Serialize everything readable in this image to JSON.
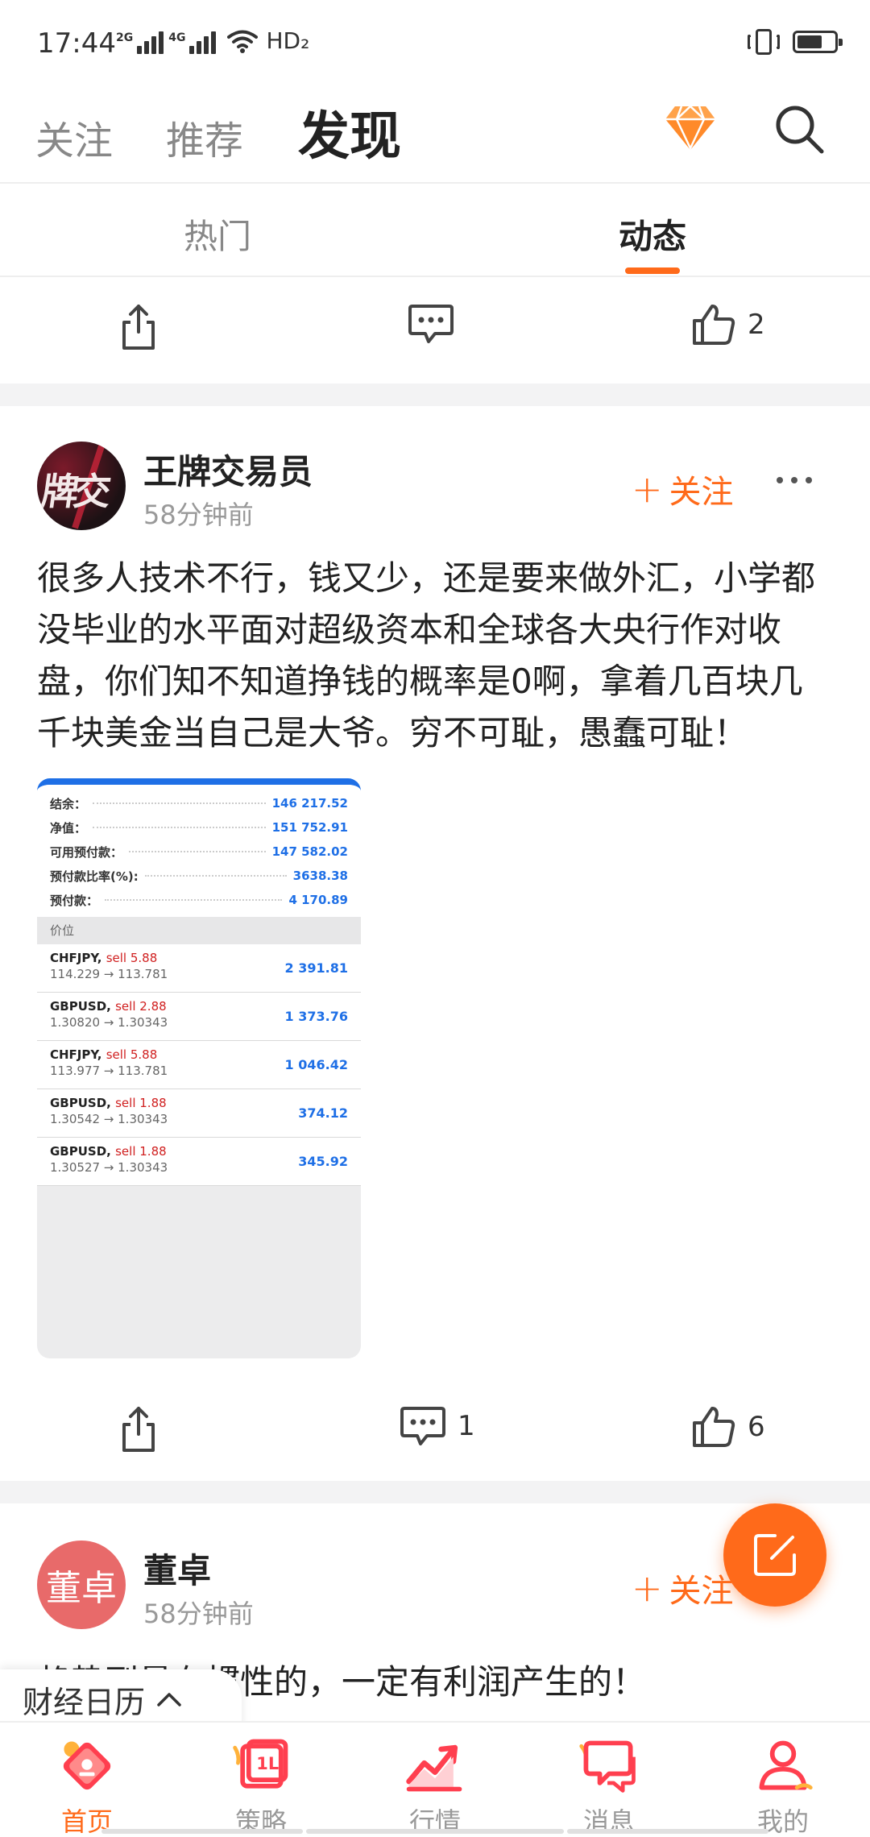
{
  "status_bar": {
    "time": "17:44",
    "network_1": "2G",
    "network_2": "4G",
    "hd": "HD₂",
    "vibrate_icon": "vibrate-icon",
    "battery_icon": "battery-icon"
  },
  "top_nav": {
    "tabs": [
      {
        "label": "关注"
      },
      {
        "label": "推荐"
      },
      {
        "label": "发现"
      }
    ],
    "active_tab": "发现",
    "diamond_icon": "diamond-icon",
    "search_icon": "search-icon"
  },
  "sub_tabs": {
    "tabs": [
      {
        "label": "热门"
      },
      {
        "label": "动态"
      }
    ],
    "active_tab": "动态"
  },
  "prev_post_actions": {
    "comments": "",
    "likes": "2"
  },
  "post1": {
    "author": "王牌交易员",
    "avatar_text": "牌交",
    "time": "58分钟前",
    "follow": "关注",
    "text": "很多人技术不行，钱又少，还是要来做外汇，小学都没毕业的水平面对超级资本和全球各大央行作对收盘，你们知不知道挣钱的概率是0啊，拿着几百块几千块美金当自己是大爷。穷不可耻，愚蠢可耻！",
    "screenshot": {
      "account": [
        {
          "label": "结余：",
          "value": "146 217.52"
        },
        {
          "label": "净值：",
          "value": "151 752.91"
        },
        {
          "label": "可用预付款：",
          "value": "147 582.02"
        },
        {
          "label": "预付款比率(%):",
          "value": "3638.38"
        },
        {
          "label": "预付款：",
          "value": "4 170.89"
        }
      ],
      "section": "价位",
      "positions": [
        {
          "symbol": "CHFJPY,",
          "side": "sell 5.88",
          "prices": "114.229 → 113.781",
          "pl": "2 391.81"
        },
        {
          "symbol": "GBPUSD,",
          "side": "sell 2.88",
          "prices": "1.30820 → 1.30343",
          "pl": "1 373.76"
        },
        {
          "symbol": "CHFJPY,",
          "side": "sell 5.88",
          "prices": "113.977 → 113.781",
          "pl": "1 046.42"
        },
        {
          "symbol": "GBPUSD,",
          "side": "sell 1.88",
          "prices": "1.30542 → 1.30343",
          "pl": "374.12"
        },
        {
          "symbol": "GBPUSD,",
          "side": "sell 1.88",
          "prices": "1.30527 → 1.30343",
          "pl": "345.92"
        }
      ]
    },
    "comments": "1",
    "likes": "6"
  },
  "post2": {
    "author": "董卓",
    "avatar_text": "董卓",
    "time": "58分钟前",
    "follow": "关注",
    "text_visible": "趋势到量有惯性的，一定有利润产生的！"
  },
  "calendar_chip": {
    "label": "财经日历"
  },
  "bottom_nav": {
    "items": [
      {
        "label": "首页",
        "icon": "home-icon"
      },
      {
        "label": "策略",
        "icon": "strategy-icon"
      },
      {
        "label": "行情",
        "icon": "market-chart-icon"
      },
      {
        "label": "消息",
        "icon": "message-icon"
      },
      {
        "label": "我的",
        "icon": "profile-icon"
      }
    ],
    "active": "首页"
  },
  "colors": {
    "accent": "#ff6a1a",
    "link_blue": "#1e6fe6",
    "sell_red": "#d02020"
  }
}
